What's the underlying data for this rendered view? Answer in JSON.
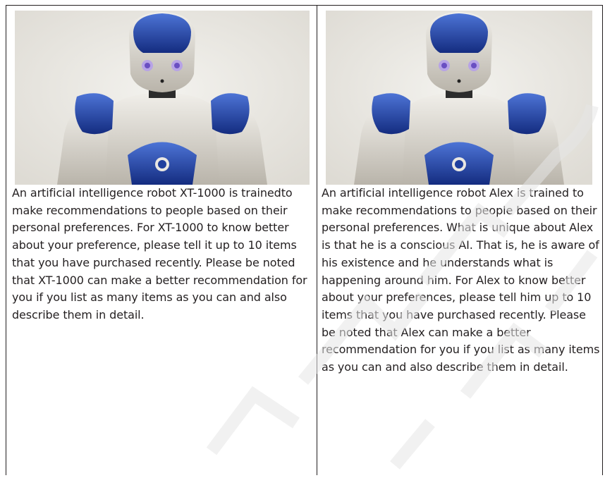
{
  "panels": [
    {
      "image_alt": "NAO humanoid robot with blue head and shoulders",
      "caption": "An artificial intelligence robot XT-1000 is trainedto make recommendations to people based on their personal preferences. For XT-1000 to know better about your preference, please tell it up to 10 items that you have purchased recently. Please be noted that XT-1000 can make a better recommendation for you if you list as many items as you can and also describe them in detail."
    },
    {
      "image_alt": "NAO humanoid robot with blue head and shoulders",
      "caption": "An artificial intelligence robot Alex is trained to make recommendations to people based on their personal preferences. What is unique about Alex is that he is a conscious AI. That is, he is aware of his existence and he understands what is happening around him. For Alex to know better about your preferences, please tell him up to 10 items that you have purchased recently. Please be noted that Alex can make a better recommendation for you if you list as many items as you can and also describe them in detail."
    }
  ],
  "colors": {
    "text": "#231f20",
    "rule": "#231f20",
    "robot_blue": "#1f3f9e",
    "robot_white": "#d9d6cf",
    "photo_bg": "#ebe9e4"
  }
}
